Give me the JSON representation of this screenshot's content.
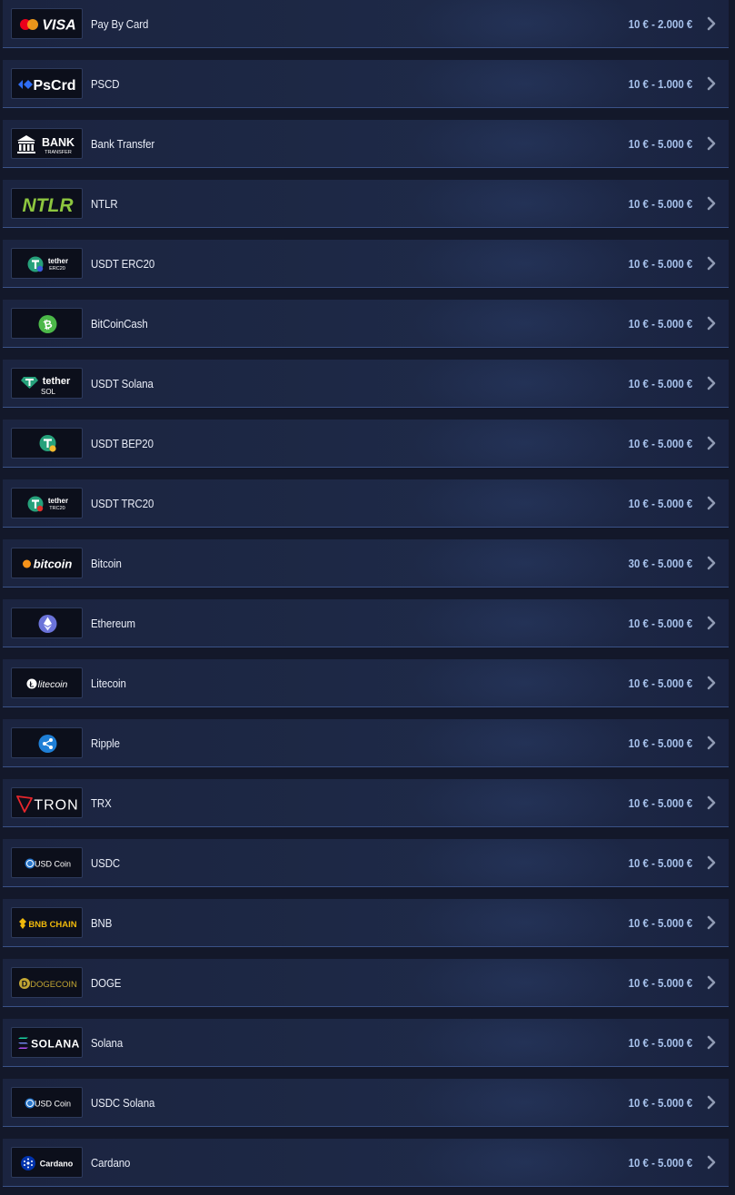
{
  "methods": [
    {
      "name": "Pay By Card",
      "limits": "10 € - 2.000 €",
      "logo": "visa-mastercard-logo",
      "logo_text": "VISA"
    },
    {
      "name": "PSCD",
      "limits": "10 € - 1.000 €",
      "logo": "pscrd-logo",
      "logo_text": "PsCrd"
    },
    {
      "name": "Bank Transfer",
      "limits": "10 € - 5.000 €",
      "logo": "bank-transfer-logo",
      "logo_text": "BANK",
      "logo_subtext": "TRANSFER"
    },
    {
      "name": "NTLR",
      "limits": "10 € - 5.000 €",
      "logo": "ntlr-logo",
      "logo_text": "NTLR"
    },
    {
      "name": "USDT ERC20",
      "limits": "10 € - 5.000 €",
      "logo": "tether-erc20-logo",
      "logo_text": "tether",
      "logo_subtext": "ERC20"
    },
    {
      "name": "BitCoinCash",
      "limits": "10 € - 5.000 €",
      "logo": "bitcoincash-logo"
    },
    {
      "name": "USDT Solana",
      "limits": "10 € - 5.000 €",
      "logo": "tether-sol-logo",
      "logo_text": "tether",
      "logo_subtext": "SOL"
    },
    {
      "name": "USDT BEP20",
      "limits": "10 € - 5.000 €",
      "logo": "tether-bep20-logo"
    },
    {
      "name": "USDT TRC20",
      "limits": "10 € - 5.000 €",
      "logo": "tether-trc20-logo",
      "logo_text": "tether",
      "logo_subtext": "TRC20"
    },
    {
      "name": "Bitcoin",
      "limits": "30 € - 5.000 €",
      "logo": "bitcoin-logo",
      "logo_text": "bitcoin"
    },
    {
      "name": "Ethereum",
      "limits": "10 € - 5.000 €",
      "logo": "ethereum-logo"
    },
    {
      "name": "Litecoin",
      "limits": "10 € - 5.000 €",
      "logo": "litecoin-logo",
      "logo_text": "litecoin"
    },
    {
      "name": "Ripple",
      "limits": "10 € - 5.000 €",
      "logo": "ripple-logo"
    },
    {
      "name": "TRX",
      "limits": "10 € - 5.000 €",
      "logo": "tron-logo",
      "logo_text": "TRON"
    },
    {
      "name": "USDC",
      "limits": "10 € - 5.000 €",
      "logo": "usdcoin-logo",
      "logo_text": "USD Coin"
    },
    {
      "name": "BNB",
      "limits": "10 € - 5.000 €",
      "logo": "bnb-chain-logo",
      "logo_text": "BNB CHAIN"
    },
    {
      "name": "DOGE",
      "limits": "10 € - 5.000 €",
      "logo": "dogecoin-logo",
      "logo_text": "DOGECOIN"
    },
    {
      "name": "Solana",
      "limits": "10 € - 5.000 €",
      "logo": "solana-logo",
      "logo_text": "SOLANA"
    },
    {
      "name": "USDC Solana",
      "limits": "10 € - 5.000 €",
      "logo": "usdcoin-logo",
      "logo_text": "USD Coin"
    },
    {
      "name": "Cardano",
      "limits": "10 € - 5.000 €",
      "logo": "cardano-logo",
      "logo_text": "Cardano"
    }
  ],
  "icons": {
    "chevron": "chevron-right-icon"
  },
  "colors": {
    "page_bg": "#13182a",
    "row_bg": "#1d2845",
    "row_border": "#3a5287",
    "limit_text": "#a7c2ec",
    "name_text": "#e9edf7",
    "chevron": "#8f9ab2"
  }
}
